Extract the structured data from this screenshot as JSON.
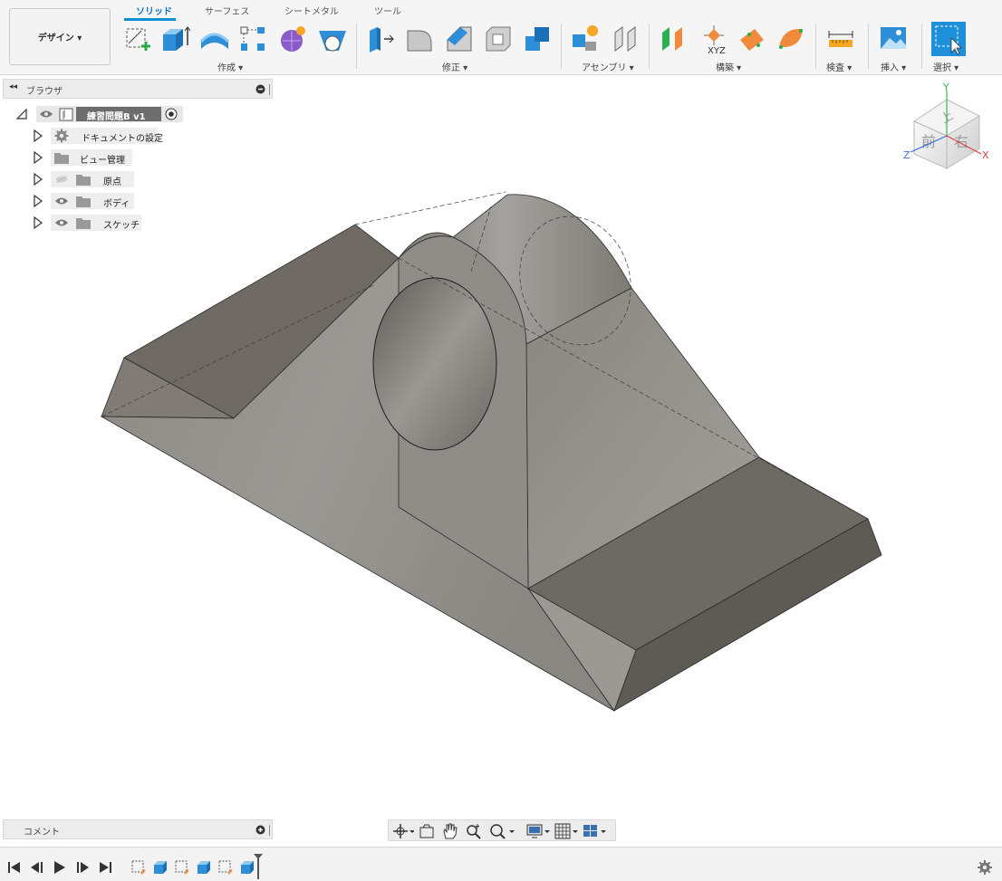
{
  "toolbar": {
    "design_label": "デザイン ▾",
    "tabs": [
      {
        "label": "ソリッド",
        "active": true
      },
      {
        "label": "サーフェス",
        "active": false
      },
      {
        "label": "シートメタル",
        "active": false
      },
      {
        "label": "ツール",
        "active": false
      }
    ],
    "groups": {
      "create": "作成 ▾",
      "modify": "修正 ▾",
      "assembly": "アセンブリ ▾",
      "construct": "構築 ▾",
      "inspect": "検査 ▾",
      "insert": "挿入 ▾",
      "select": "選択 ▾"
    },
    "xyz_label": "XYZ"
  },
  "browser": {
    "title": "ブラウザ",
    "root": "練習問題B v1",
    "items": [
      {
        "label": "ドキュメントの設定",
        "icon": "gear-icon"
      },
      {
        "label": "ビュー管理",
        "icon": "folder-icon"
      },
      {
        "label": "原点",
        "icon": "folder-icon"
      },
      {
        "label": "ボディ",
        "icon": "folder-icon"
      },
      {
        "label": "スケッチ",
        "icon": "folder-icon"
      }
    ]
  },
  "viewcube": {
    "top": "上",
    "front": "前",
    "right": "右",
    "axis_x": "X",
    "axis_y": "Y",
    "axis_z": "Z"
  },
  "comments": {
    "title": "コメント"
  },
  "colors": {
    "accent": "#0b8fd6",
    "select_blue": "#1e8fd9",
    "model_face": "#8f8c86"
  }
}
